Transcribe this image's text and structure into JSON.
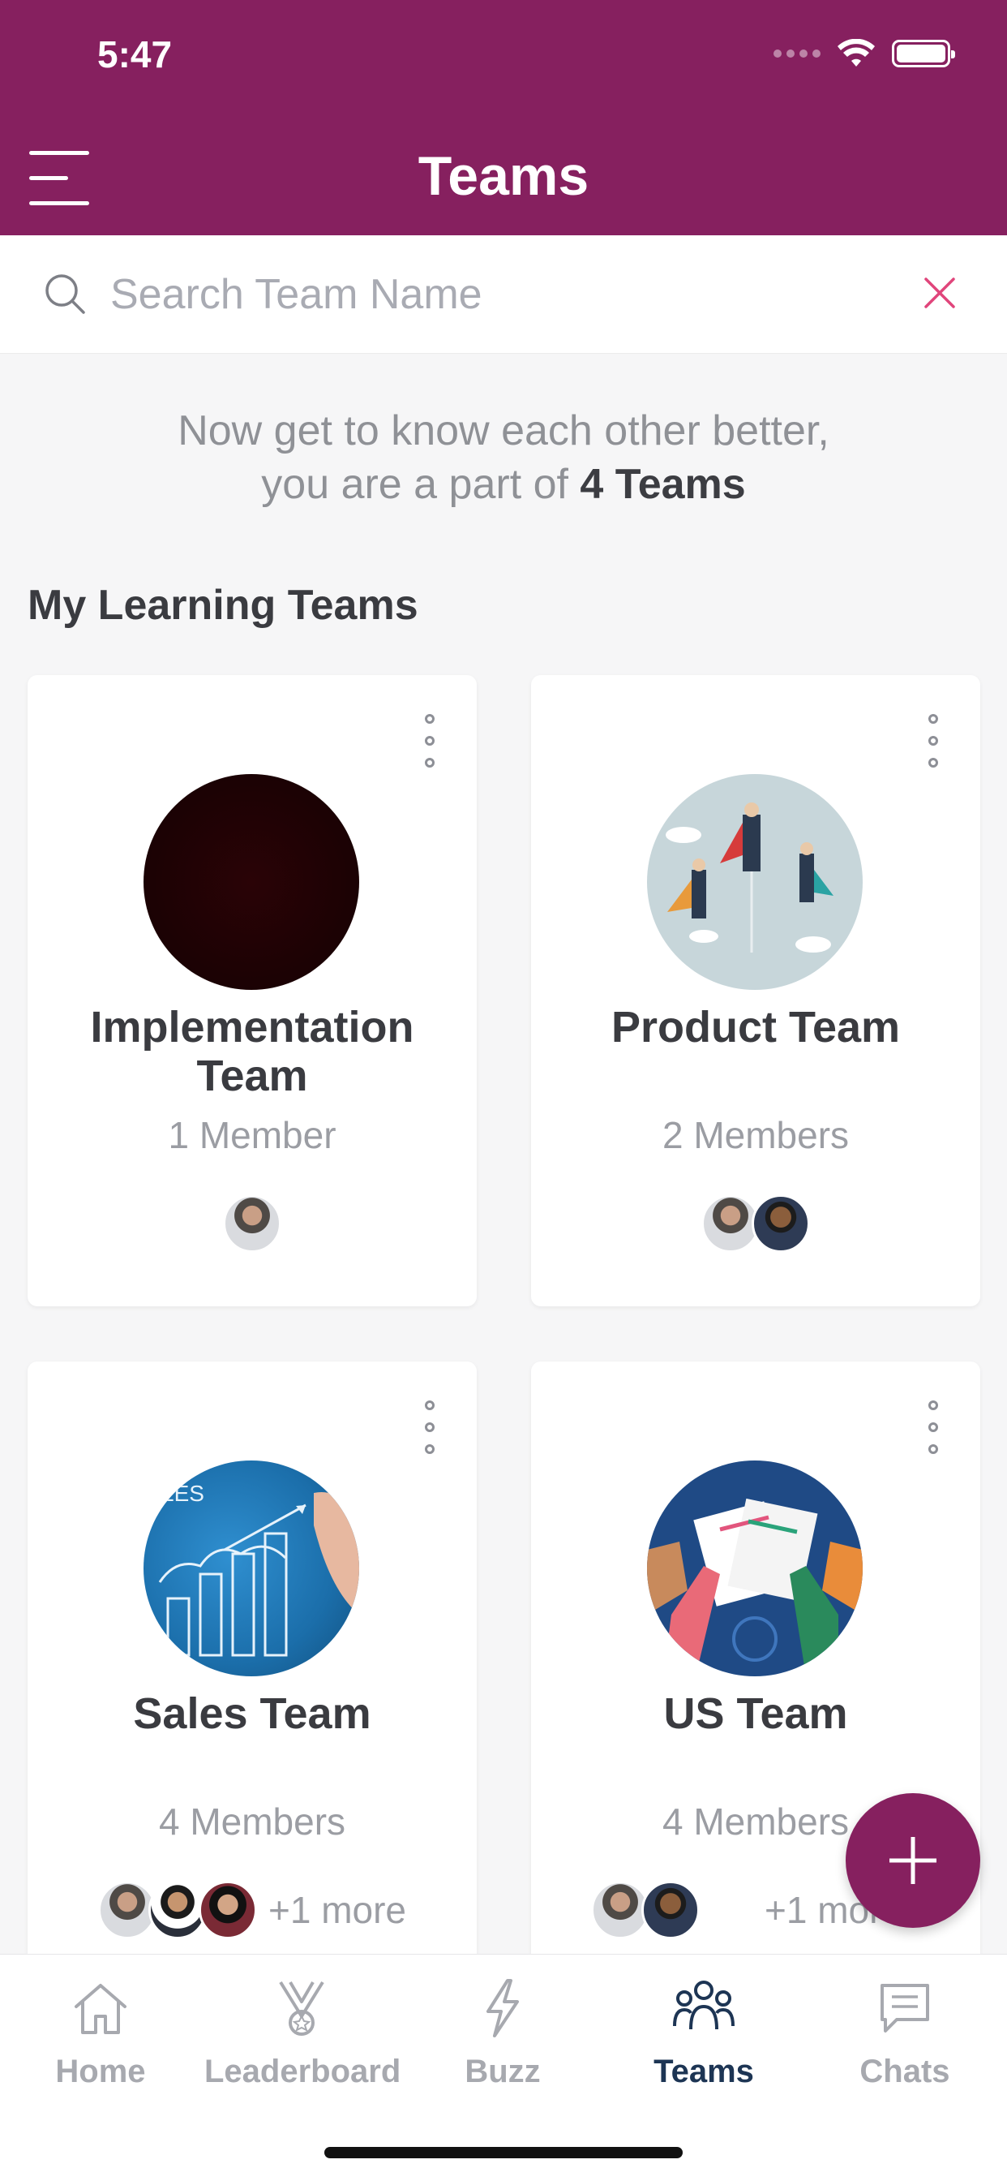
{
  "status_bar": {
    "time": "5:47"
  },
  "header": {
    "title": "Teams"
  },
  "search": {
    "placeholder": "Search Team Name",
    "value": ""
  },
  "intro": {
    "line1": "Now get to know each other better,",
    "line2_prefix": "you are a part of",
    "line2_count": "4 Teams"
  },
  "section_title": "My Learning Teams",
  "teams": [
    {
      "name": "Implementation Team",
      "members": "1 Member",
      "extra": ""
    },
    {
      "name": "Product Team",
      "members": "2 Members",
      "extra": ""
    },
    {
      "name": "Sales Team",
      "members": "4 Members",
      "extra": "+1 more",
      "image_text": "LES"
    },
    {
      "name": "US Team",
      "members": "4 Members",
      "extra": "+1 more"
    }
  ],
  "tabs": [
    {
      "label": "Home",
      "icon": "home-icon"
    },
    {
      "label": "Leaderboard",
      "icon": "trophy-icon"
    },
    {
      "label": "Buzz",
      "icon": "lightning-icon"
    },
    {
      "label": "Teams",
      "icon": "people-icon",
      "active": true
    },
    {
      "label": "Chats",
      "icon": "chat-icon"
    }
  ],
  "colors": {
    "brand": "#86205f",
    "active_tab": "#1d3554",
    "muted": "#a7a9af",
    "clear_icon": "#e0457b"
  }
}
